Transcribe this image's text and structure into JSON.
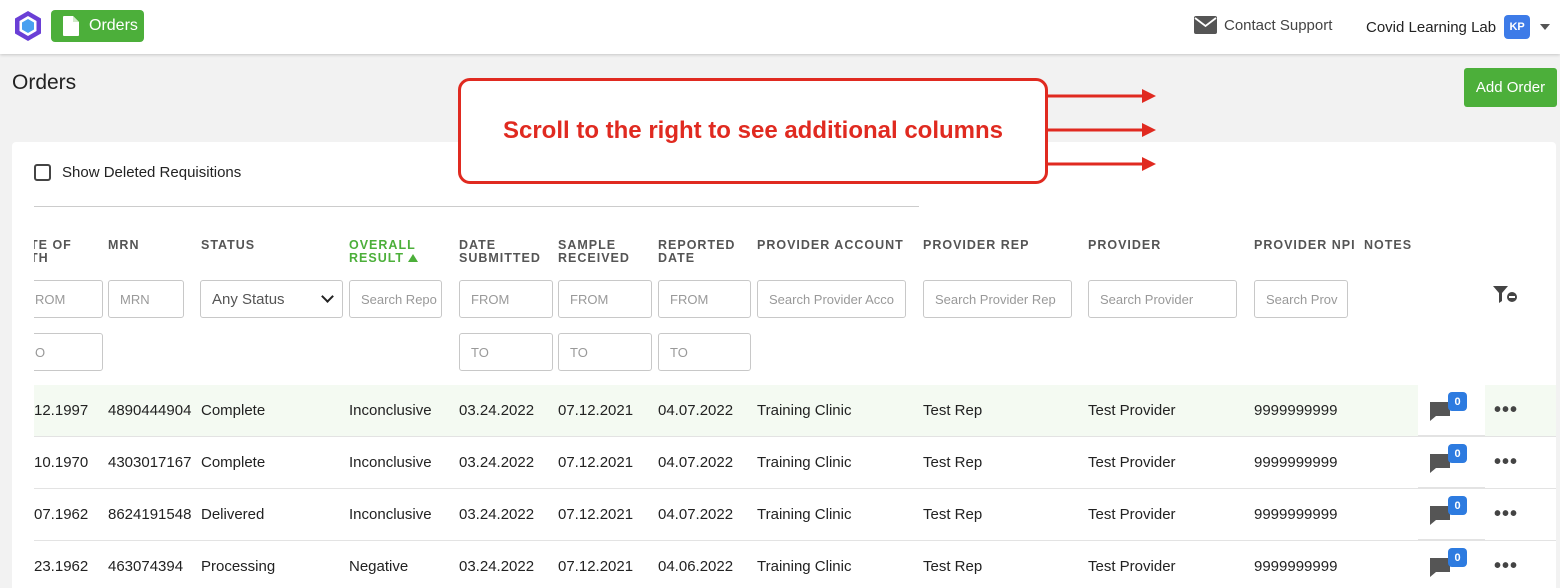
{
  "topbar": {
    "orders_label": "Orders",
    "support_label": "Contact Support",
    "account_name": "Covid Learning Lab",
    "avatar_initials": "KP"
  },
  "page": {
    "title": "Orders",
    "add_order_label": "Add Order",
    "show_deleted_label": "Show Deleted Requisitions"
  },
  "annotation": {
    "text": "Scroll to the right to see additional columns"
  },
  "columns": {
    "dob": "TE OF\nTH",
    "mrn": "MRN",
    "status": "STATUS",
    "overall_result": "OVERALL\nRESULT",
    "date_submitted": "DATE\nSUBMITTED",
    "sample_received": "SAMPLE\nRECEIVED",
    "reported_date": "REPORTED\nDATE",
    "provider_account": "PROVIDER ACCOUNT",
    "provider_rep": "PROVIDER REP",
    "provider": "PROVIDER",
    "provider_npi": "PROVIDER NPI",
    "notes": "NOTES"
  },
  "filters": {
    "dob_from": "ROM",
    "dob_to": "O",
    "mrn": "MRN",
    "status": "Any Status",
    "overall_result": "Search Repo",
    "date_submitted_from": "FROM",
    "date_submitted_to": "TO",
    "sample_received_from": "FROM",
    "sample_received_to": "TO",
    "reported_from": "FROM",
    "reported_to": "TO",
    "provider_account": "Search Provider Acco",
    "provider_rep": "Search Provider Rep",
    "provider": "Search Provider",
    "provider_npi": "Search Prov"
  },
  "rows": [
    {
      "dob": "12.1997",
      "mrn": "4890444904",
      "status": "Complete",
      "result": "Inconclusive",
      "submitted": "03.24.2022",
      "received": "07.12.2021",
      "reported": "04.07.2022",
      "account": "Training Clinic",
      "rep": "Test Rep",
      "provider": "Test Provider",
      "npi": "9999999999",
      "notes_count": "0"
    },
    {
      "dob": "10.1970",
      "mrn": "4303017167",
      "status": "Complete",
      "result": "Inconclusive",
      "submitted": "03.24.2022",
      "received": "07.12.2021",
      "reported": "04.07.2022",
      "account": "Training Clinic",
      "rep": "Test Rep",
      "provider": "Test Provider",
      "npi": "9999999999",
      "notes_count": "0"
    },
    {
      "dob": "07.1962",
      "mrn": "8624191548",
      "status": "Delivered",
      "result": "Inconclusive",
      "submitted": "03.24.2022",
      "received": "07.12.2021",
      "reported": "04.07.2022",
      "account": "Training Clinic",
      "rep": "Test Rep",
      "provider": "Test Provider",
      "npi": "9999999999",
      "notes_count": "0"
    },
    {
      "dob": "23.1962",
      "mrn": "463074394",
      "status": "Processing",
      "result": "Negative",
      "submitted": "03.24.2022",
      "received": "07.12.2021",
      "reported": "04.06.2022",
      "account": "Training Clinic",
      "rep": "Test Rep",
      "provider": "Test Provider",
      "npi": "9999999999",
      "notes_count": "0"
    }
  ],
  "colors": {
    "brand_green": "#4caf3a",
    "annotation_red": "#e02a20",
    "badge_blue": "#2d7be0"
  }
}
